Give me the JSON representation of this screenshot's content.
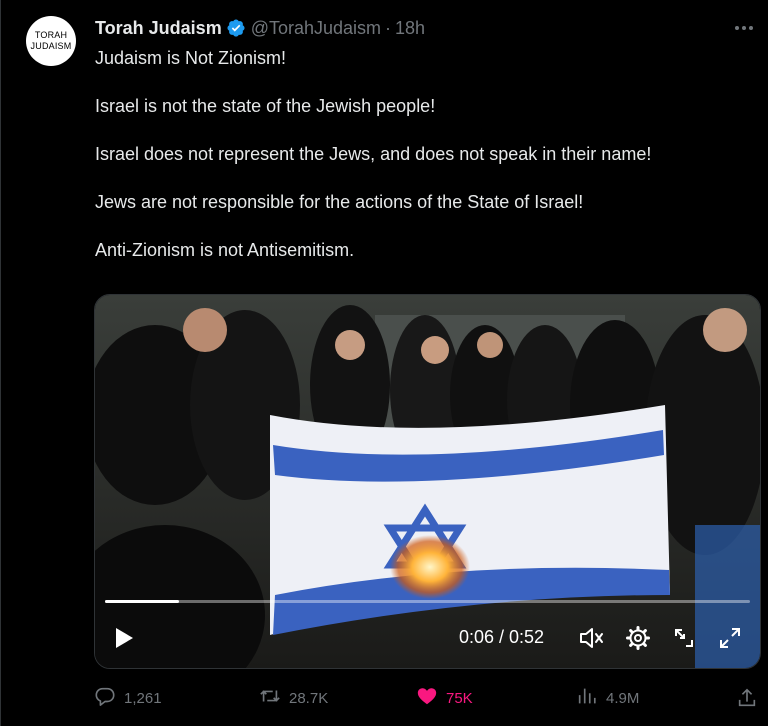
{
  "tweet": {
    "avatar_text_line1": "TORAH",
    "avatar_text_line2": "JUDAISM",
    "display_name": "Torah Judaism",
    "handle": "@TorahJudaism",
    "separator": "·",
    "time": "18h",
    "verified_color": "#1d9bf0",
    "more_icon": "ellipsis-icon",
    "paragraphs": [
      "Judaism is Not Zionism!",
      "Israel is not the state of the Jewish people!",
      "Israel does not represent the Jews, and does not speak in their name!",
      "Jews are not responsible for the actions of the State of Israel!",
      "Anti-Zionism is not Antisemitism."
    ]
  },
  "video": {
    "current_time": "0:06",
    "duration": "0:52",
    "time_text": "0:06 / 0:52",
    "progress_fraction": 0.115,
    "muted": true,
    "icons": [
      "play-icon",
      "mute-icon",
      "settings-gear-icon",
      "pip-icon",
      "fullscreen-icon"
    ]
  },
  "actions": {
    "replies": "1,261",
    "reposts": "28.7K",
    "likes": "75K",
    "views": "4.9M",
    "like_color": "#f91880",
    "icons": [
      "reply-icon",
      "repost-icon",
      "like-heart-icon",
      "views-icon",
      "share-icon"
    ]
  }
}
